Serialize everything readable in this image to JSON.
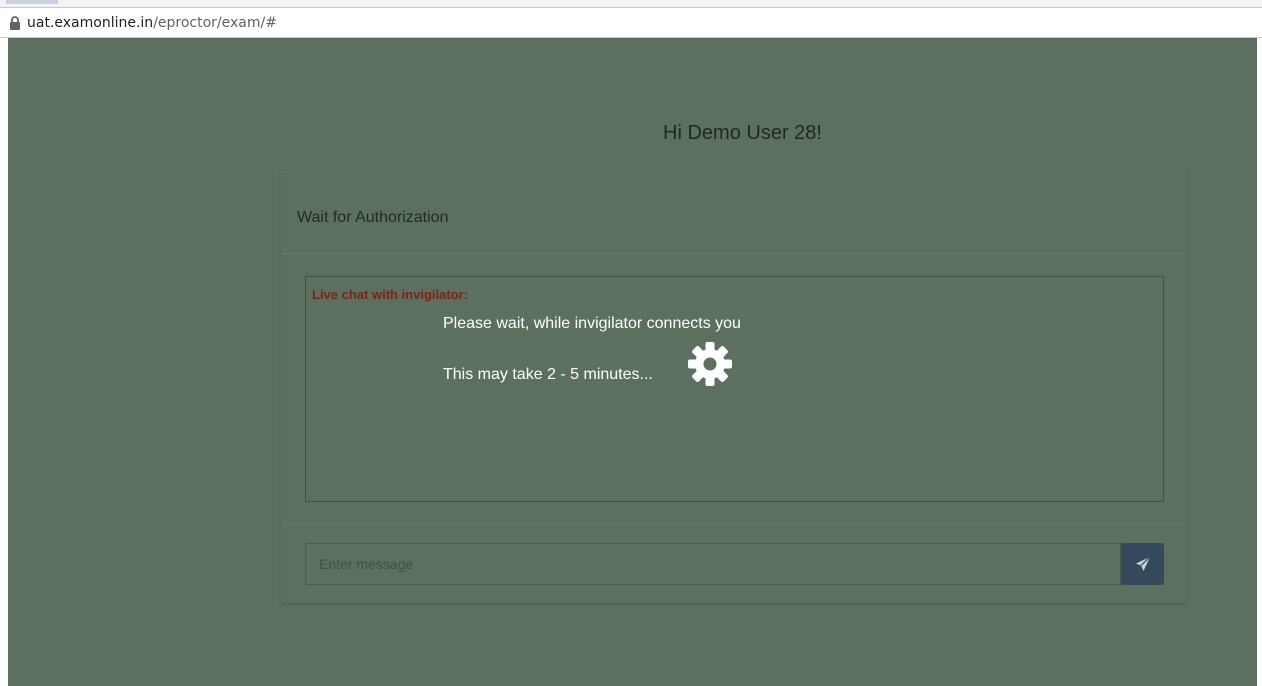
{
  "browser": {
    "url_host": "uat.examonline.in",
    "url_path": "/eproctor/exam/#"
  },
  "page": {
    "greeting": "Hi Demo User 28!",
    "card_title": "Wait for Authorization",
    "chat_label": "Live chat with invigilator:",
    "wait_message": "Please wait, while invigilator connects you",
    "wait_duration": "This may take 2 - 5 minutes...",
    "spinner_icon": "gear-icon"
  },
  "footer": {
    "message_placeholder": "Enter message",
    "send_icon": "paper-plane-icon"
  },
  "colors": {
    "overlay_background": "#5d6f5f",
    "chat_label": "#7a2418",
    "send_button": "#34495c"
  }
}
